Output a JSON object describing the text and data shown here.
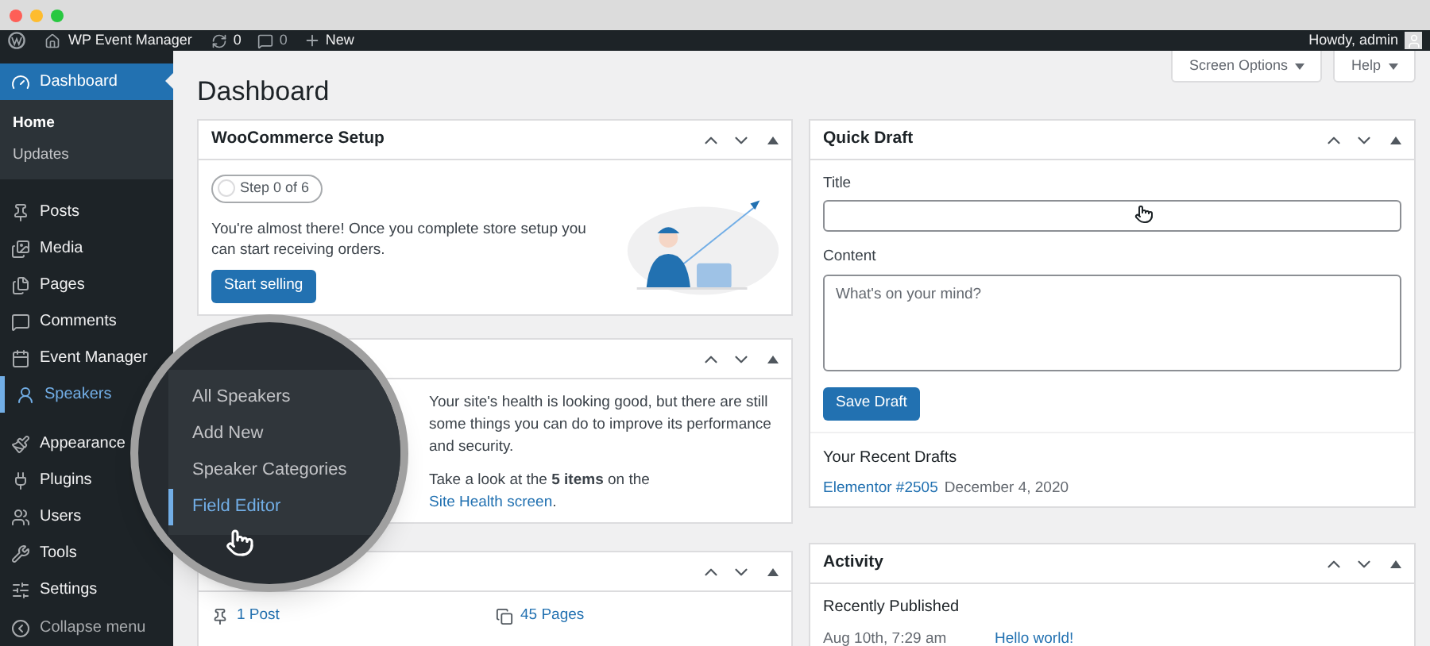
{
  "admin_bar": {
    "site": "WP Event Manager",
    "updates": "0",
    "comments": "0",
    "new": "New",
    "greeting": "Howdy, admin"
  },
  "sidebar": {
    "items": [
      {
        "label": "Dashboard",
        "selected": true,
        "open": false,
        "children": [
          {
            "label": "Home",
            "selected": true
          },
          {
            "label": "Updates",
            "selected": false
          }
        ]
      },
      {
        "label": "Posts",
        "selected": false,
        "open": false
      },
      {
        "label": "Media",
        "selected": false,
        "open": false
      },
      {
        "label": "Pages",
        "selected": false,
        "open": false
      },
      {
        "label": "Comments",
        "selected": false,
        "open": false
      },
      {
        "label": "Event Manager",
        "selected": false,
        "open": false
      },
      {
        "label": "Speakers",
        "selected": false,
        "open": true
      },
      {
        "label": "Appearance",
        "selected": false,
        "open": false
      },
      {
        "label": "Plugins",
        "selected": false,
        "open": false
      },
      {
        "label": "Users",
        "selected": false,
        "open": false
      },
      {
        "label": "Tools",
        "selected": false,
        "open": false
      },
      {
        "label": "Settings",
        "selected": false,
        "open": false
      }
    ],
    "collapse": "Collapse menu"
  },
  "magnifier": {
    "items": [
      {
        "label": "All Speakers",
        "selected": false
      },
      {
        "label": "Add New",
        "selected": false
      },
      {
        "label": "Speaker Categories",
        "selected": false
      },
      {
        "label": "Field Editor",
        "selected": true
      }
    ]
  },
  "header": {
    "title": "Dashboard",
    "buttons": [
      "Screen Options",
      "Help"
    ]
  },
  "woocommerce": {
    "title": "WooCommerce Setup",
    "step": "Step 0 of 6",
    "text": "You're almost there! Once you complete store setup you can start receiving orders.",
    "button": "Start selling"
  },
  "site_health": {
    "text": "Your site's health is looking good, but there are still some things you can do to improve its performance and security.",
    "note": "Take a look at the **5 items** on the ",
    "link": "Site Health screen",
    "note_end": "."
  },
  "glance": {
    "items": [
      "1 Post",
      "45 Pages"
    ]
  },
  "quick_draft": {
    "title": "Quick Draft",
    "title_label": "Title",
    "content_label": "Content",
    "content_placeholder": "What's on your mind?",
    "button": "Save Draft",
    "recent_heading": "Your Recent Drafts",
    "drafts": [
      {
        "link": "Elementor #2505",
        "date": "December 4, 2020"
      }
    ]
  },
  "activity": {
    "title": "Activity",
    "heading": "Recently Published",
    "rows": [
      {
        "date": "Aug 10th, 7:29 am",
        "link": "Hello world!"
      }
    ]
  }
}
